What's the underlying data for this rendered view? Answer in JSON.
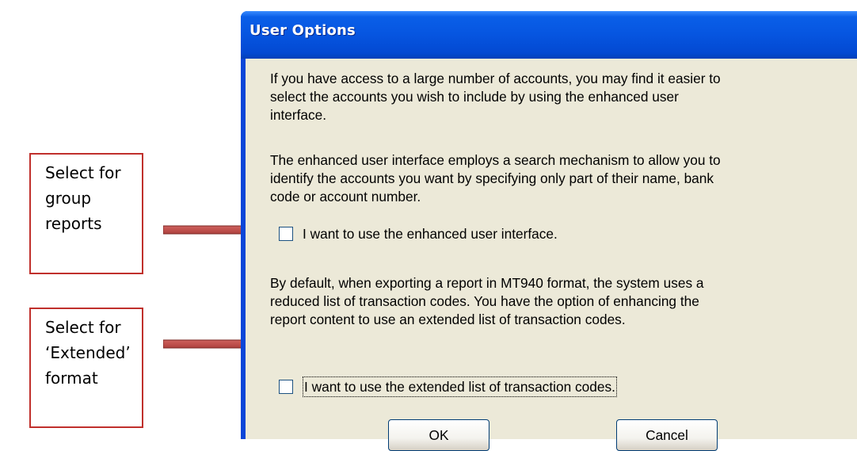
{
  "callouts": [
    {
      "lines": [
        "Select for",
        "group",
        "reports"
      ]
    },
    {
      "lines": [
        "Select for",
        "‘Extended’",
        "format"
      ]
    }
  ],
  "colors": {
    "callout_border": "#c0302c",
    "arrow": "#c0504d",
    "titlebar": "#0655e0",
    "dialog_background": "#ece9d8"
  },
  "dialog": {
    "title": "User Options",
    "paragraph_1": "If you have access to a large number of accounts, you may find it easier to\nselect the accounts you wish to include by using the enhanced user\ninterface.",
    "paragraph_2": "The enhanced user interface employs a search mechanism to allow you to\nidentify the accounts you want by specifying only part of their name, bank\ncode or account number.",
    "checkbox_1": {
      "label": "I want to use the enhanced user interface.",
      "checked": false
    },
    "paragraph_3": "By default, when exporting a report in MT940 format, the system uses a\nreduced list of transaction codes.  You have the option of enhancing the\nreport content to use an extended list of transaction codes.",
    "checkbox_2": {
      "label": "I want to use the extended list of transaction codes.",
      "checked": false
    },
    "ok_label": "OK",
    "cancel_label": "Cancel"
  }
}
